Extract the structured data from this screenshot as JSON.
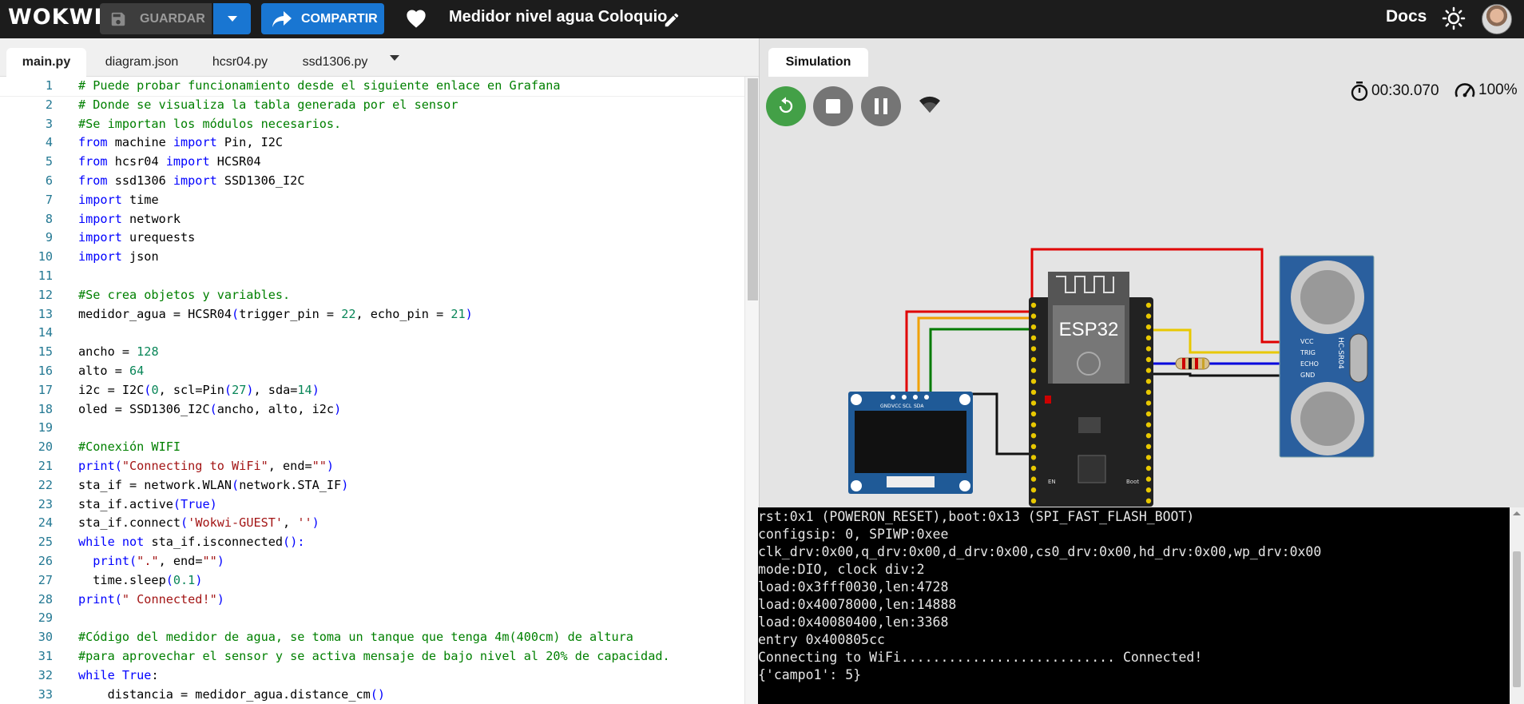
{
  "header": {
    "logo": "WOKWI",
    "save_label": "GUARDAR",
    "share_label": "COMPARTIR",
    "project_title": "Medidor nivel agua Coloquio",
    "docs_label": "Docs"
  },
  "editor": {
    "tabs": [
      {
        "label": "main.py",
        "active": true
      },
      {
        "label": "diagram.json",
        "active": false
      },
      {
        "label": "hcsr04.py",
        "active": false
      },
      {
        "label": "ssd1306.py",
        "active": false
      }
    ],
    "lines": [
      [
        {
          "t": "# Puede probar funcionamiento desde el siguiente enlace en Grafana",
          "c": "c"
        }
      ],
      [
        {
          "t": "# Donde se visualiza la tabla generada por el sensor",
          "c": "c"
        }
      ],
      [
        {
          "t": "#Se importan los módulos necesarios.",
          "c": "c"
        }
      ],
      [
        {
          "t": "from",
          "c": "k"
        },
        {
          "t": " machine "
        },
        {
          "t": "import",
          "c": "k"
        },
        {
          "t": " Pin, I2C"
        }
      ],
      [
        {
          "t": "from",
          "c": "k"
        },
        {
          "t": " hcsr04 "
        },
        {
          "t": "import",
          "c": "k"
        },
        {
          "t": " HCSR04"
        }
      ],
      [
        {
          "t": "from",
          "c": "k"
        },
        {
          "t": " ssd1306 "
        },
        {
          "t": "import",
          "c": "k"
        },
        {
          "t": " SSD1306_I2C"
        }
      ],
      [
        {
          "t": "import",
          "c": "k"
        },
        {
          "t": " time"
        }
      ],
      [
        {
          "t": "import",
          "c": "k"
        },
        {
          "t": " network"
        }
      ],
      [
        {
          "t": "import",
          "c": "k"
        },
        {
          "t": " urequests"
        }
      ],
      [
        {
          "t": "import",
          "c": "k"
        },
        {
          "t": " json"
        }
      ],
      [],
      [
        {
          "t": "#Se crea objetos y variables.",
          "c": "c"
        }
      ],
      [
        {
          "t": "medidor_agua = HCSR04"
        },
        {
          "t": "(",
          "c": "b"
        },
        {
          "t": "trigger_pin = "
        },
        {
          "t": "22",
          "c": "n"
        },
        {
          "t": ", echo_pin = "
        },
        {
          "t": "21",
          "c": "n"
        },
        {
          "t": ")",
          "c": "b"
        }
      ],
      [],
      [
        {
          "t": "ancho = "
        },
        {
          "t": "128",
          "c": "n"
        }
      ],
      [
        {
          "t": "alto = "
        },
        {
          "t": "64",
          "c": "n"
        }
      ],
      [
        {
          "t": "i2c = I2C"
        },
        {
          "t": "(",
          "c": "b"
        },
        {
          "t": "0",
          "c": "n"
        },
        {
          "t": ", scl=Pin"
        },
        {
          "t": "(",
          "c": "b"
        },
        {
          "t": "27",
          "c": "n"
        },
        {
          "t": ")",
          "c": "b"
        },
        {
          "t": ", sda="
        },
        {
          "t": "14",
          "c": "n"
        },
        {
          "t": ")",
          "c": "b"
        }
      ],
      [
        {
          "t": "oled = SSD1306_I2C"
        },
        {
          "t": "(",
          "c": "b"
        },
        {
          "t": "ancho, alto, i2c"
        },
        {
          "t": ")",
          "c": "b"
        }
      ],
      [],
      [
        {
          "t": "#Conexión WIFI",
          "c": "c"
        }
      ],
      [
        {
          "t": "print",
          "c": "k"
        },
        {
          "t": "(",
          "c": "b"
        },
        {
          "t": "\"Connecting to WiFi\"",
          "c": "s"
        },
        {
          "t": ", end="
        },
        {
          "t": "\"\"",
          "c": "s"
        },
        {
          "t": ")",
          "c": "b"
        }
      ],
      [
        {
          "t": "sta_if = network.WLAN"
        },
        {
          "t": "(",
          "c": "b"
        },
        {
          "t": "network.STA_IF"
        },
        {
          "t": ")",
          "c": "b"
        }
      ],
      [
        {
          "t": "sta_if.active"
        },
        {
          "t": "(",
          "c": "b"
        },
        {
          "t": "True",
          "c": "k"
        },
        {
          "t": ")",
          "c": "b"
        }
      ],
      [
        {
          "t": "sta_if.connect"
        },
        {
          "t": "(",
          "c": "b"
        },
        {
          "t": "'Wokwi-GUEST'",
          "c": "s"
        },
        {
          "t": ", "
        },
        {
          "t": "''",
          "c": "s"
        },
        {
          "t": ")",
          "c": "b"
        }
      ],
      [
        {
          "t": "while",
          "c": "k"
        },
        {
          "t": " "
        },
        {
          "t": "not",
          "c": "k"
        },
        {
          "t": " sta_if.isconnected"
        },
        {
          "t": "():",
          "c": "b"
        }
      ],
      [
        {
          "t": "  "
        },
        {
          "t": "print",
          "c": "k"
        },
        {
          "t": "(",
          "c": "b"
        },
        {
          "t": "\".\"",
          "c": "s"
        },
        {
          "t": ", end="
        },
        {
          "t": "\"\"",
          "c": "s"
        },
        {
          "t": ")",
          "c": "b"
        }
      ],
      [
        {
          "t": "  time.sleep"
        },
        {
          "t": "(",
          "c": "b"
        },
        {
          "t": "0.1",
          "c": "n"
        },
        {
          "t": ")",
          "c": "b"
        }
      ],
      [
        {
          "t": "print",
          "c": "k"
        },
        {
          "t": "(",
          "c": "b"
        },
        {
          "t": "\" Connected!\"",
          "c": "s"
        },
        {
          "t": ")",
          "c": "b"
        }
      ],
      [],
      [
        {
          "t": "#Código del medidor de agua, se toma un tanque que tenga 4m(400cm) de altura",
          "c": "c"
        }
      ],
      [
        {
          "t": "#para aprovechar el sensor y se activa mensaje de bajo nivel al 20% de capacidad.",
          "c": "c"
        }
      ],
      [
        {
          "t": "while",
          "c": "k"
        },
        {
          "t": " "
        },
        {
          "t": "True",
          "c": "k"
        },
        {
          "t": ":"
        }
      ],
      [
        {
          "t": "    distancia = medidor_agua.distance_cm"
        },
        {
          "t": "()",
          "c": "b"
        }
      ]
    ]
  },
  "simulation": {
    "tab_label": "Simulation",
    "timer": "00:30.070",
    "speed": "100%",
    "esp32_label": "ESP32",
    "sensor_label": "HC-SR04",
    "sensor_pins": [
      "VCC",
      "TRIG",
      "ECHO",
      "GND"
    ],
    "oled_pins": [
      "GND",
      "VCC",
      "SCL",
      "SDA"
    ],
    "boot_label": "Boot",
    "en_label": "EN"
  },
  "serial": {
    "lines": [
      "rst:0x1 (POWERON_RESET),boot:0x13 (SPI_FAST_FLASH_BOOT)",
      "configsip: 0, SPIWP:0xee",
      "clk_drv:0x00,q_drv:0x00,d_drv:0x00,cs0_drv:0x00,hd_drv:0x00,wp_drv:0x00",
      "mode:DIO, clock div:2",
      "load:0x3fff0030,len:4728",
      "load:0x40078000,len:14888",
      "load:0x40080400,len:3368",
      "entry 0x400805cc",
      "Connecting to WiFi........................... Connected!",
      "{'campo1': 5}"
    ]
  },
  "colors": {
    "topbar": "#1c1c1c",
    "primary": "#1976d2",
    "run_green": "#43a047",
    "control_grey": "#757575"
  }
}
